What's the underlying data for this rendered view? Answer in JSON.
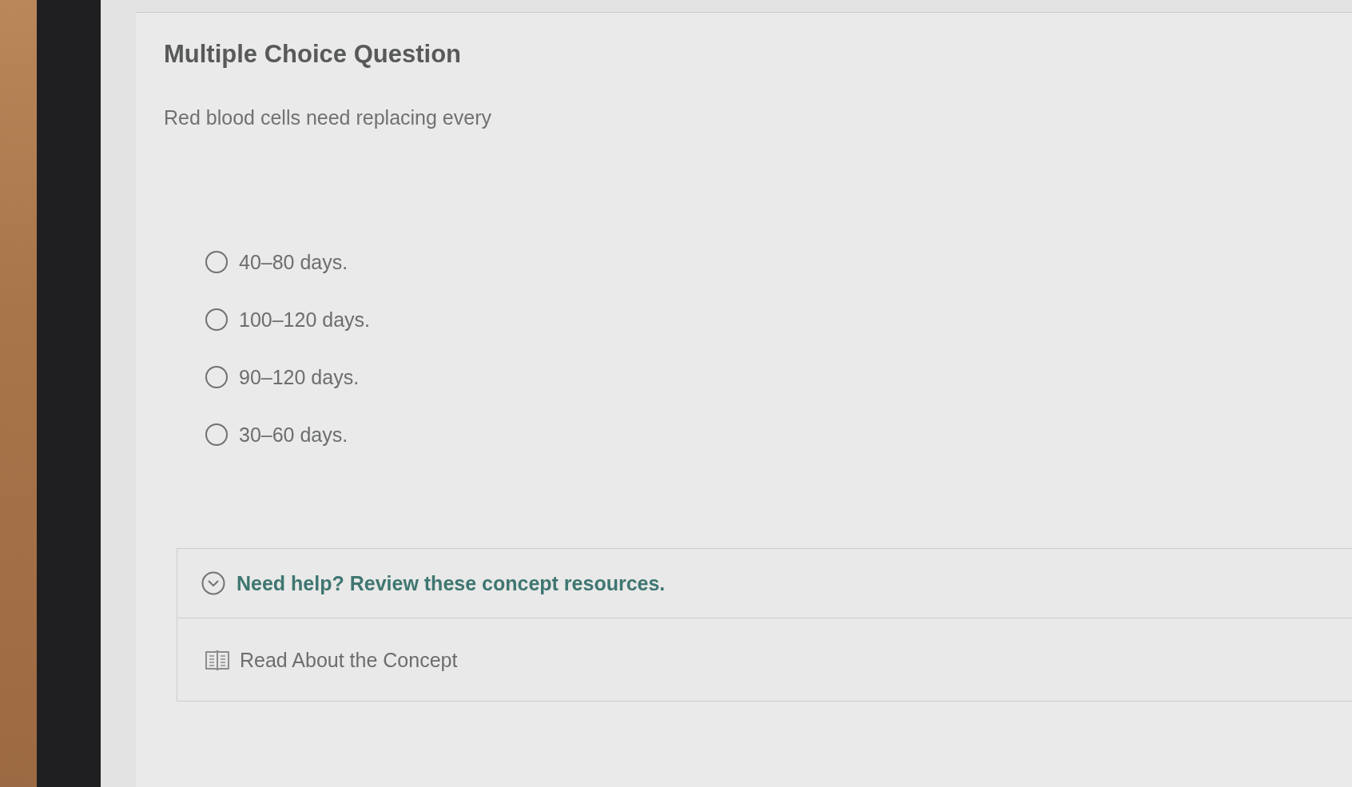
{
  "question": {
    "heading": "Multiple Choice Question",
    "prompt": "Red blood cells need replacing every",
    "options": [
      {
        "label": "40–80 days.",
        "selected": false
      },
      {
        "label": "100–120 days.",
        "selected": false
      },
      {
        "label": "90–120 days.",
        "selected": false
      },
      {
        "label": "30–60 days.",
        "selected": false
      }
    ]
  },
  "help": {
    "title": "Need help? Review these concept resources.",
    "expanded": true,
    "resources": [
      {
        "kind": "reading",
        "label": "Read About the Concept"
      }
    ]
  }
}
